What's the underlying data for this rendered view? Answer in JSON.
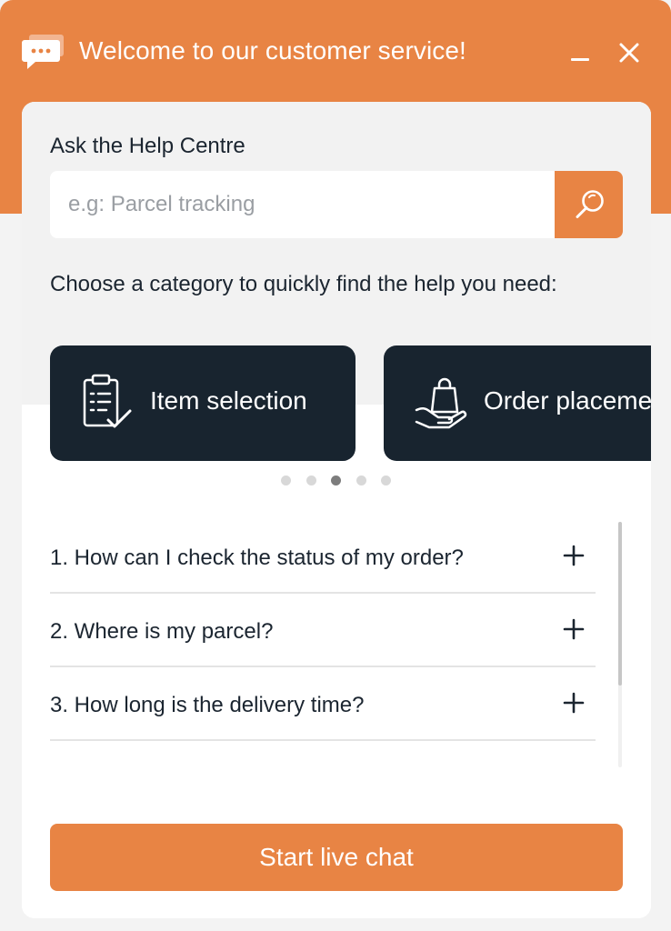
{
  "header": {
    "title": "Welcome to our customer service!",
    "chat_icon": "chat-bubble-icon",
    "minimize_icon": "minimize-icon",
    "close_icon": "close-icon"
  },
  "search": {
    "label": "Ask the Help Centre",
    "placeholder": "e.g: Parcel tracking",
    "value": "",
    "button_icon": "search-icon"
  },
  "categories": {
    "intro": "Choose a category to quickly find the help you need:",
    "items": [
      {
        "label": "Item selection",
        "icon": "clipboard-check-icon"
      },
      {
        "label": "Order placement",
        "icon": "shopping-bag-hand-icon"
      }
    ],
    "dots_total": 5,
    "active_dot": 3
  },
  "faq": {
    "items": [
      {
        "question": "1. How can I check the status of my order?"
      },
      {
        "question": "2. Where is my parcel?"
      },
      {
        "question": "3. How long is the delivery time?"
      }
    ],
    "expand_icon": "plus-icon"
  },
  "footer": {
    "chat_button_label": "Start live chat"
  },
  "colors": {
    "brand": "#e88444",
    "card": "#18242f",
    "text": "#1b2530"
  }
}
